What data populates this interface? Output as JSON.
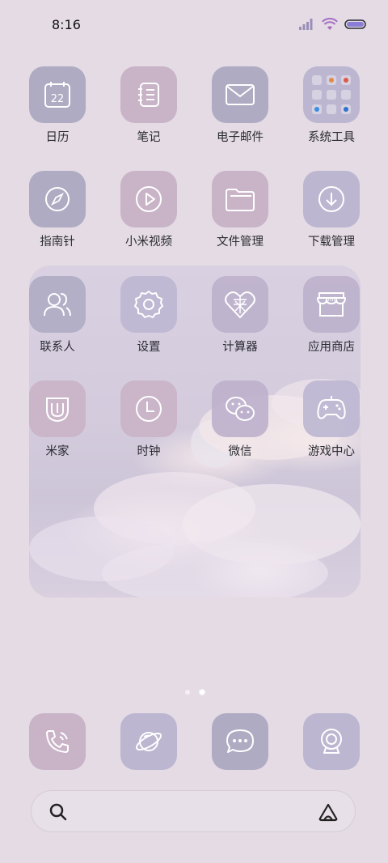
{
  "status_bar": {
    "time": "8:16"
  },
  "apps": {
    "calendar": {
      "label": "日历",
      "day": "22"
    },
    "notes": {
      "label": "笔记"
    },
    "email": {
      "label": "电子邮件"
    },
    "system_tools": {
      "label": "系统工具"
    },
    "compass": {
      "label": "指南针"
    },
    "mi_video": {
      "label": "小米视频"
    },
    "file_manager": {
      "label": "文件管理"
    },
    "download_manager": {
      "label": "下载管理"
    },
    "contacts": {
      "label": "联系人"
    },
    "settings": {
      "label": "设置"
    },
    "calculator": {
      "label": "计算器"
    },
    "app_store": {
      "label": "应用商店",
      "logo_text": "mi"
    },
    "mi_home": {
      "label": "米家"
    },
    "clock": {
      "label": "时钟"
    },
    "wechat": {
      "label": "微信"
    },
    "game_center": {
      "label": "游戏中心"
    }
  },
  "page_indicator": {
    "pages": 2,
    "current": 2
  },
  "colors": {
    "icon_blue": "#aeabc3",
    "icon_pink": "#c9b3c7",
    "icon_lavender": "#bcb6d1",
    "background": "#e4dbe4"
  }
}
